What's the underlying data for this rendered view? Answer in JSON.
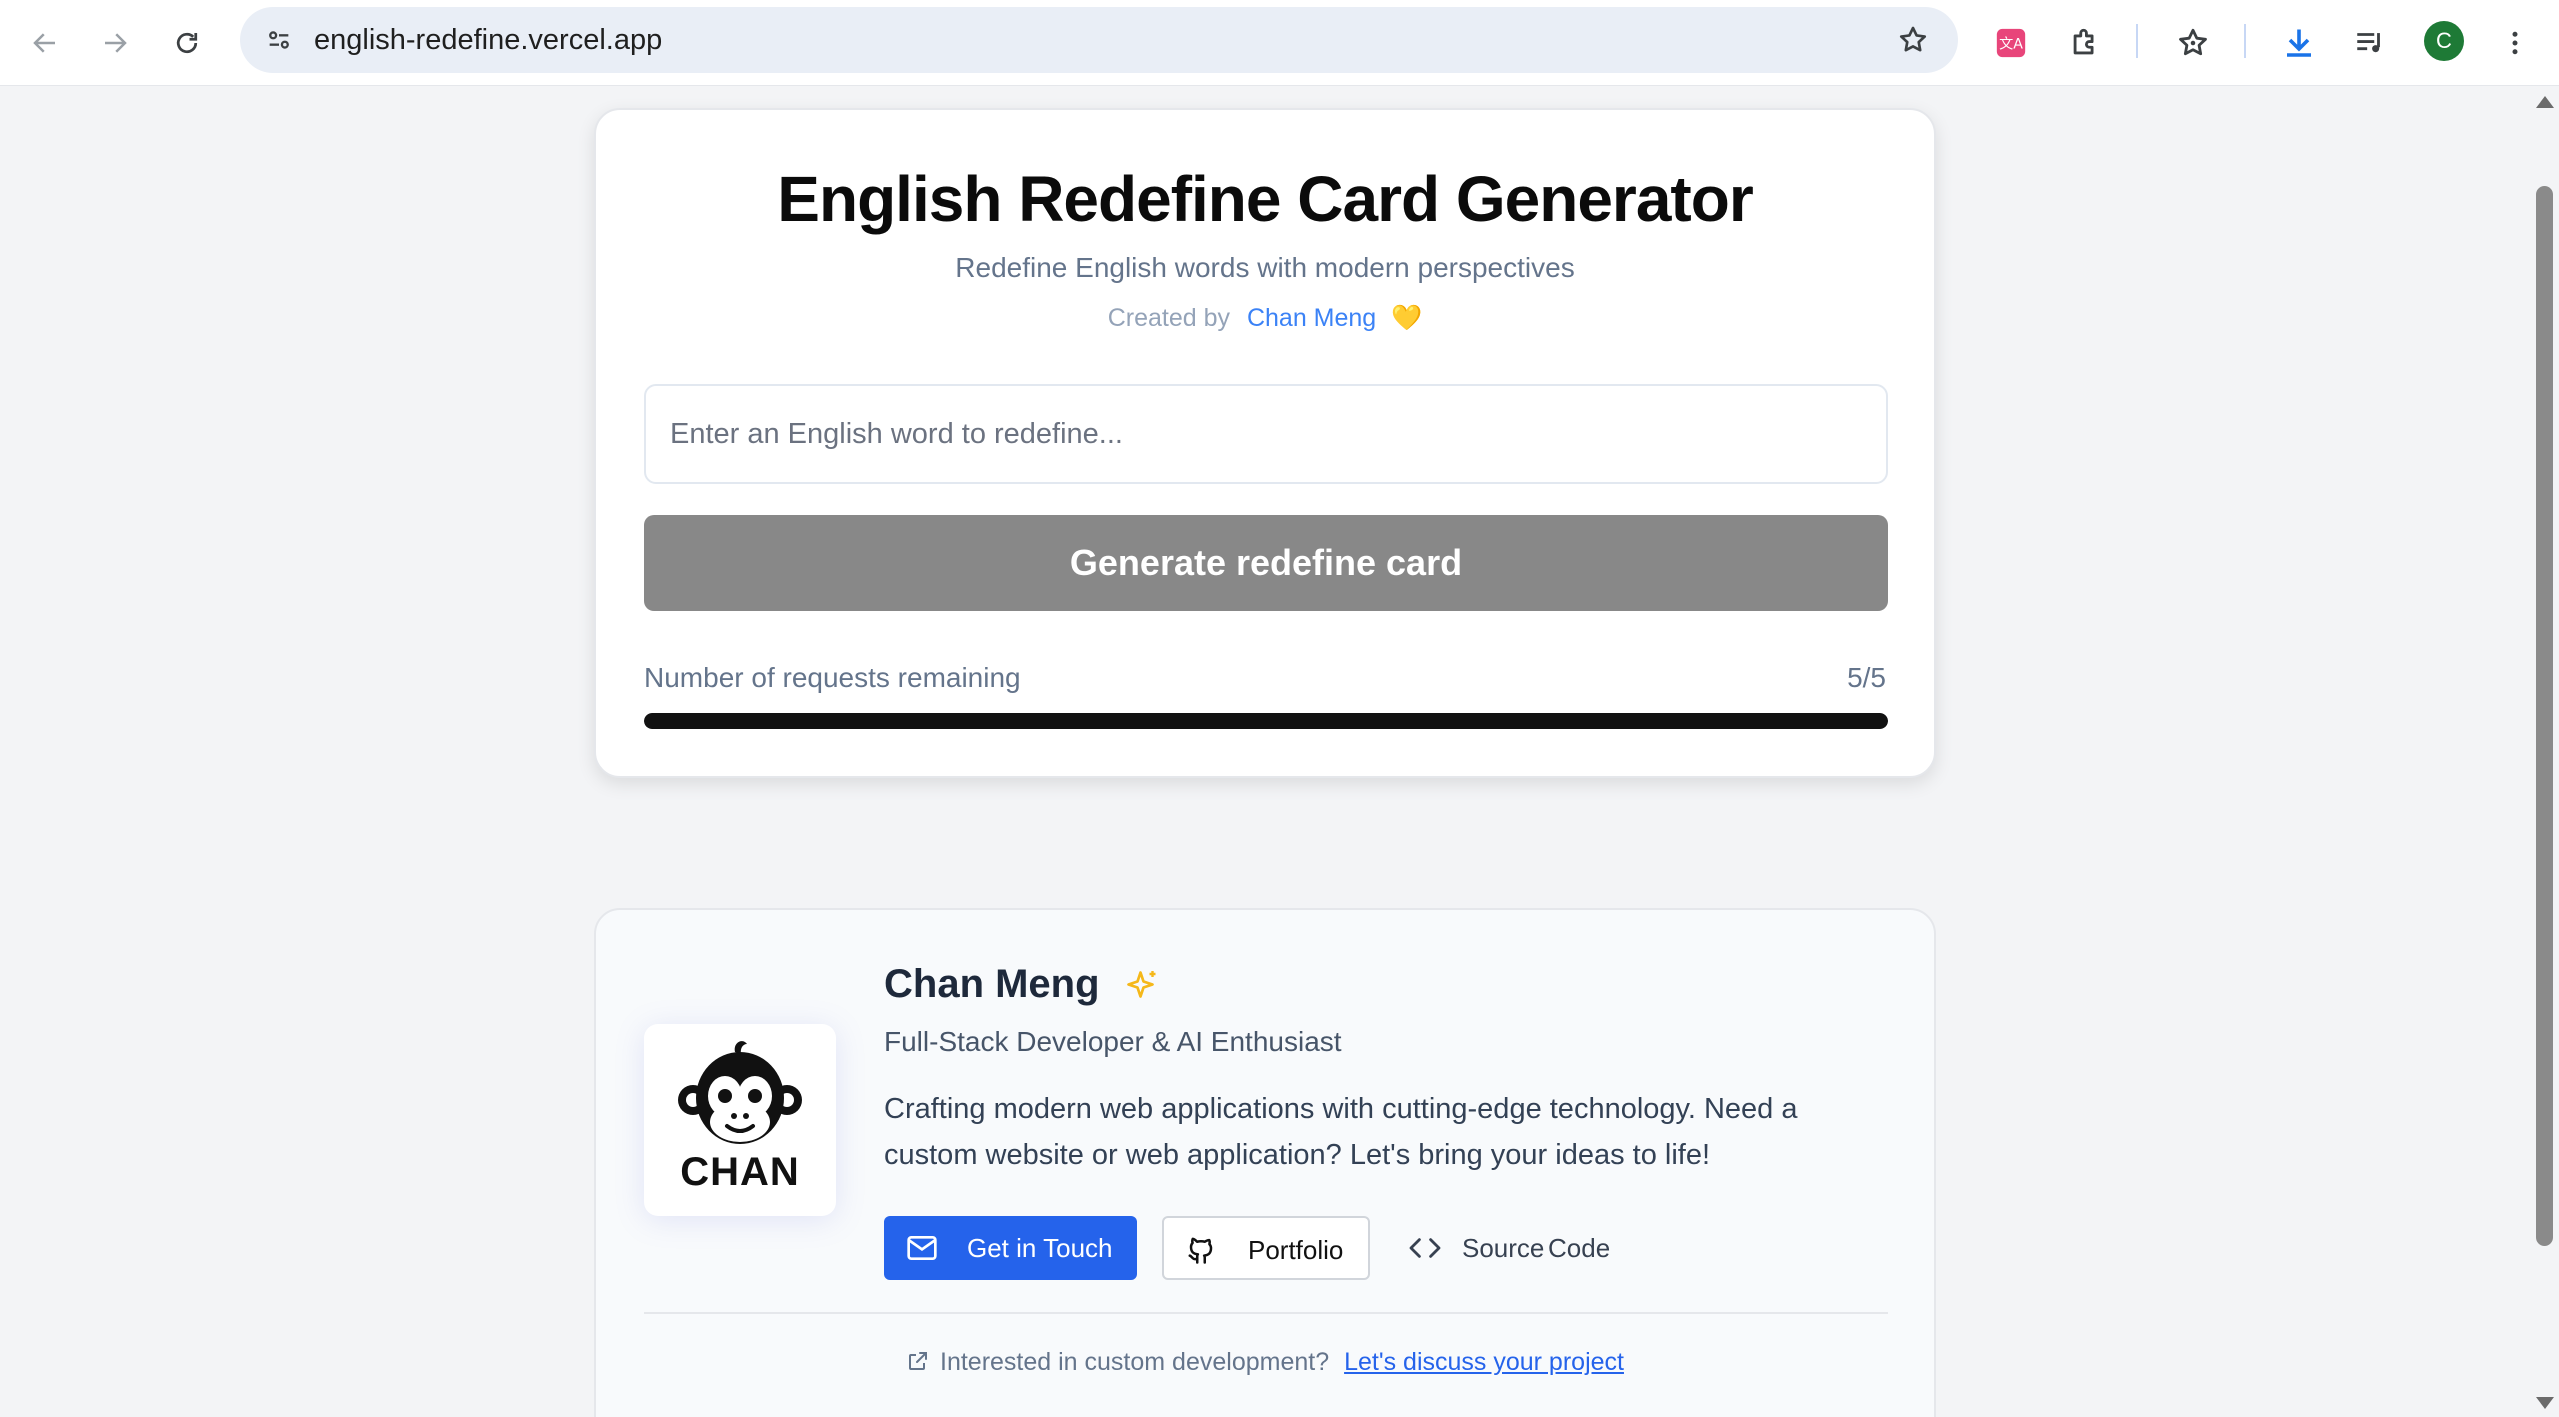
{
  "browser": {
    "url": "english-redefine.vercel.app",
    "avatar_letter": "C"
  },
  "generator": {
    "title": "English Redefine Card Generator",
    "subtitle": "Redefine English words with modern perspectives",
    "created_by_label": "Created by",
    "author": "Chan Meng",
    "heart": "💛",
    "input_placeholder": "Enter an English word to redefine...",
    "input_value": "",
    "button_label": "Generate redefine card",
    "requests_label": "Number of requests remaining",
    "requests_count": "5/5",
    "requests_fraction": 1.0
  },
  "profile": {
    "name": "Chan Meng",
    "role": "Full-Stack Developer & AI Enthusiast",
    "bio_line1": "Crafting modern web applications with cutting-edge technology. Need a",
    "bio_line2": "custom website or web application? Let's bring your ideas to life!",
    "logo_text": "CHAN",
    "buttons": {
      "get_in_touch": "Get in Touch",
      "portfolio": "Portfolio",
      "source": "Source",
      "code": "Code"
    },
    "cta_text": "Interested in custom development?",
    "cta_link": "Let's discuss your project"
  },
  "colors": {
    "primary": "#2563eb",
    "button_disabled": "#888888",
    "progress": "#111111",
    "accent_gold": "#f5b81a"
  }
}
